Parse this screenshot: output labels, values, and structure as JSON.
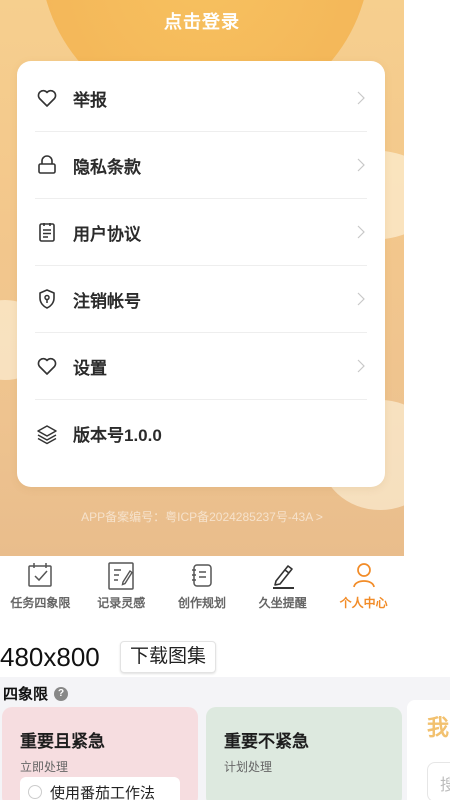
{
  "header": {
    "login_text": "点击登录"
  },
  "menu": [
    {
      "label": "举报",
      "icon": "heart-icon"
    },
    {
      "label": "隐私条款",
      "icon": "lock-icon"
    },
    {
      "label": "用户协议",
      "icon": "document-icon"
    },
    {
      "label": "注销帐号",
      "icon": "shield-icon"
    },
    {
      "label": "设置",
      "icon": "heart-icon"
    },
    {
      "label": "版本号1.0.0",
      "icon": "layers-icon"
    }
  ],
  "footer_icp": "APP备案编号：粤ICP备2024285237号-43A >",
  "tabbar": [
    {
      "label": "任务四象限",
      "icon": "calendar-check-icon",
      "active": false
    },
    {
      "label": "记录灵感",
      "icon": "note-edit-icon",
      "active": false
    },
    {
      "label": "创作规划",
      "icon": "notebook-icon",
      "active": false
    },
    {
      "label": "久坐提醒",
      "icon": "pen-icon",
      "active": false
    },
    {
      "label": "个人中心",
      "icon": "person-icon",
      "active": true
    }
  ],
  "preview": {
    "size_label": "480x800",
    "download_label": "下载图集"
  },
  "section": {
    "title": "四象限",
    "quadrants": [
      {
        "title": "重要且紧急",
        "subtitle": "立即处理",
        "task": "使用番茄工作法"
      },
      {
        "title": "重要不紧急",
        "subtitle": "计划处理"
      }
    ],
    "side_char": "我",
    "side_search": "搜"
  },
  "colors": {
    "accent": "#f28c28",
    "card_bg": "#ffffff",
    "bg_gradient_top": "#f6cf8e"
  }
}
